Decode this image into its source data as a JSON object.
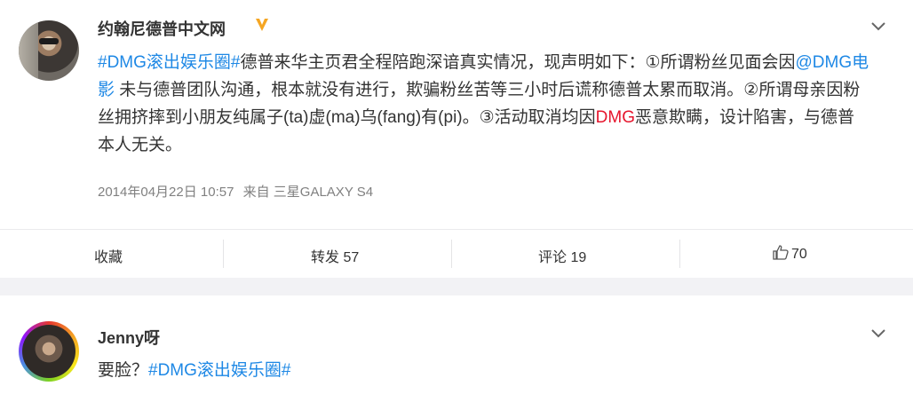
{
  "post": {
    "author": "约翰尼德普中文网",
    "verified_icon": "verified-v-icon",
    "text": {
      "tag1": "#DMG滚出娱乐圈#",
      "p1": "德普来华主页君全程陪跑深谙真实情况，现声明如下：①所谓粉丝见面会因",
      "mention": "@DMG电影",
      "p2": " 未与德普团队沟通，根本就没有进行，欺骗粉丝苦等三小时后谎称德普太累而取消。②所谓母亲因粉丝拥挤摔到小朋友纯属子(ta)虚(ma)乌(fang)有(pi)。③活动取消均因",
      "red": "DMG",
      "p3": "恶意欺瞒，设计陷害，与德普本人无关。"
    },
    "timestamp": "2014年04月22日 10:57",
    "source": "来自 三星GALAXY S4",
    "actions": {
      "favorite": "收藏",
      "repost": "转发 57",
      "comment": "评论 19",
      "likes": "70"
    }
  },
  "comment": {
    "author": "Jenny呀",
    "text_prefix": "要脸？",
    "tag": "#DMG滚出娱乐圈#"
  },
  "colors": {
    "tag": "#1e88e5",
    "mention": "#eb7350",
    "red": "#e6162d",
    "verified": "#f5a623"
  }
}
